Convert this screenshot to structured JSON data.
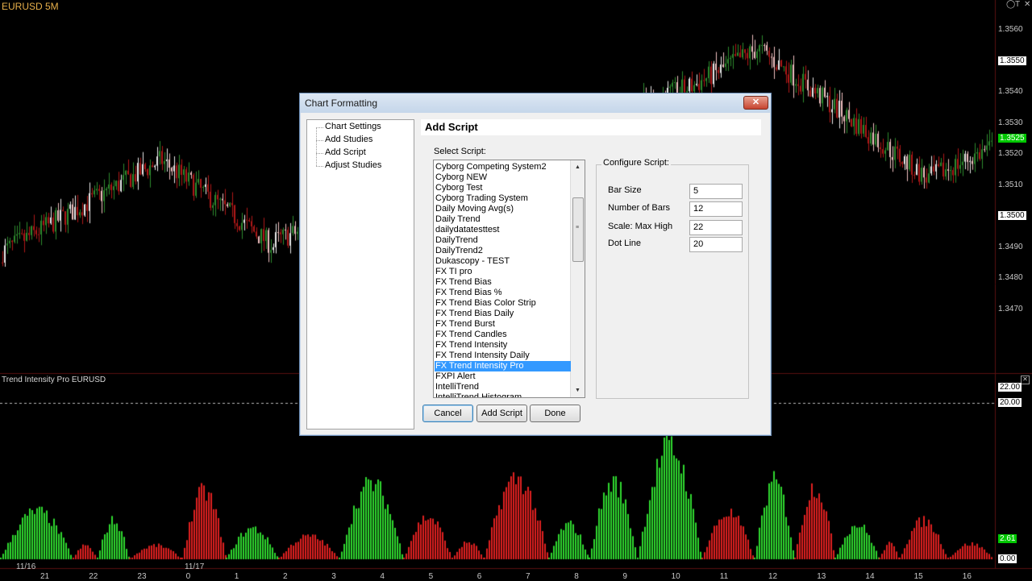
{
  "chart": {
    "symbol": "EURUSD 5M",
    "study_title": "Trend Intensity Pro EURUSD",
    "window_controls": [
      "◯",
      "T",
      "✕"
    ],
    "price_axis": [
      "1.3560",
      "1.3550",
      "1.3540",
      "1.3530",
      "1.3525",
      "1.3520",
      "1.3510",
      "1.3500",
      "1.3490",
      "1.3480",
      "1.3470"
    ],
    "price_highlight": {
      "1.3550": "#ffffff",
      "1.3500": "#ffffff",
      "1.3525": "#00c800"
    },
    "study_axis": [
      "22.00",
      "20.00",
      "2.61",
      "0.00"
    ],
    "study_highlight": {
      "22.00": "#ffffff",
      "20.00": "#ffffff",
      "2.61": "#00c800",
      "0.00": "#ffffff"
    },
    "date_labels": [
      "11/16",
      "11/17"
    ],
    "hour_labels": [
      "21",
      "22",
      "23",
      "0",
      "1",
      "2",
      "3",
      "4",
      "5",
      "6",
      "7",
      "8",
      "9",
      "10",
      "11",
      "12",
      "13",
      "14",
      "15",
      "16"
    ],
    "colors": {
      "up": "#2fd82f",
      "down": "#e02020",
      "candle_up": "#2e8b2e",
      "candle_down": "#b01818",
      "grid": "#3a0808"
    }
  },
  "dialog": {
    "title": "Chart Formatting",
    "close_label": "✕",
    "tree": [
      "Chart Settings",
      "Add Studies",
      "Add Script",
      "Adjust Studies"
    ],
    "header": "Add Script",
    "select_label": "Select Script:",
    "scripts": [
      "Cyborg Competing System2",
      "Cyborg NEW",
      "Cyborg Test",
      "Cyborg Trading System",
      "Daily Moving Avg(s)",
      "Daily Trend",
      "dailydatatesttest",
      "DailyTrend",
      "DailyTrend2",
      "Dukascopy - TEST",
      "FX TI pro",
      "FX Trend Bias",
      "FX Trend Bias %",
      "FX Trend Bias Color Strip",
      "FX Trend Bias Daily",
      "FX Trend Burst",
      "FX Trend Candles",
      "FX Trend Intensity",
      "FX Trend Intensity Daily",
      "FX Trend Intensity Pro",
      "FXPI Alert",
      "IntelliTrend",
      "IntelliTrend Histogram"
    ],
    "selected_index": 19,
    "configure_label": "Configure Script:",
    "params": [
      {
        "label": "Bar Size",
        "value": "5"
      },
      {
        "label": "Number of Bars",
        "value": "12"
      },
      {
        "label": "Scale: Max High",
        "value": "22"
      },
      {
        "label": "Dot Line",
        "value": "20"
      }
    ],
    "buttons": {
      "cancel": "Cancel",
      "add": "Add Script",
      "done": "Done"
    }
  }
}
